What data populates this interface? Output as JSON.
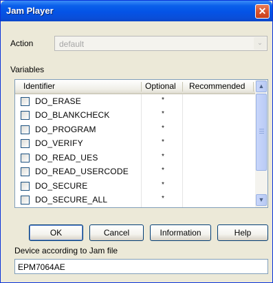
{
  "window": {
    "title": "Jam Player",
    "close_glyph": "✕"
  },
  "action": {
    "label": "Action",
    "value": "default",
    "arrow_glyph": "⌄"
  },
  "variables": {
    "label": "Variables",
    "columns": {
      "identifier": "Identifier",
      "optional": "Optional",
      "recommended": "Recommended"
    },
    "rows": [
      {
        "identifier": "DO_ERASE",
        "optional": "*",
        "recommended": ""
      },
      {
        "identifier": "DO_BLANKCHECK",
        "optional": "*",
        "recommended": ""
      },
      {
        "identifier": "DO_PROGRAM",
        "optional": "*",
        "recommended": ""
      },
      {
        "identifier": "DO_VERIFY",
        "optional": "*",
        "recommended": ""
      },
      {
        "identifier": "DO_READ_UES",
        "optional": "*",
        "recommended": ""
      },
      {
        "identifier": "DO_READ_USERCODE",
        "optional": "*",
        "recommended": ""
      },
      {
        "identifier": "DO_SECURE",
        "optional": "*",
        "recommended": ""
      },
      {
        "identifier": "DO_SECURE_ALL",
        "optional": "*",
        "recommended": ""
      }
    ],
    "scroll_up_glyph": "▲",
    "scroll_down_glyph": "▼"
  },
  "buttons": {
    "ok": "OK",
    "cancel": "Cancel",
    "information": "Information",
    "help": "Help"
  },
  "device": {
    "label": "Device according to Jam file",
    "value": "EPM7064AE"
  },
  "colors": {
    "titlebar": "#0453E6",
    "dialog_bg": "#ECE9D8",
    "close_button": "#D9532E"
  }
}
